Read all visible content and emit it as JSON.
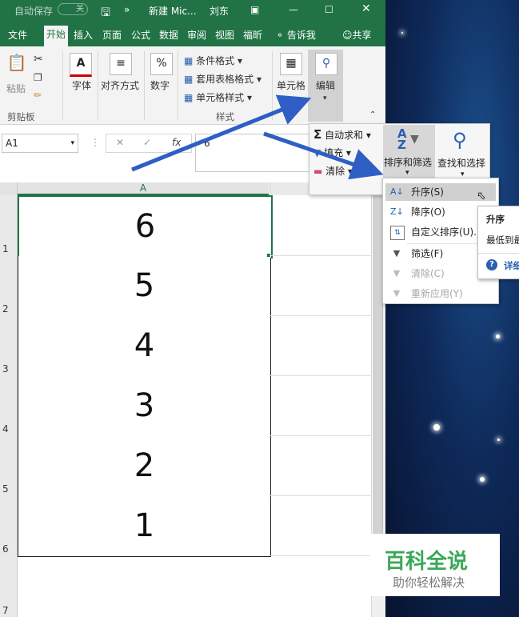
{
  "titlebar": {
    "autosave": "自动保存",
    "autosave_state": "关",
    "doc_title": "新建 Mic...",
    "user": "刘东"
  },
  "tabs": [
    "文件",
    "开始",
    "插入",
    "页面",
    "公式",
    "数据",
    "审阅",
    "视图",
    "福昕",
    "告诉我",
    "共享"
  ],
  "ribbon": {
    "paste": "粘贴",
    "clipboard_group": "剪贴板",
    "font": "字体",
    "align": "对齐方式",
    "number": "数字",
    "number_icon": "%",
    "cond_format": "条件格式",
    "table_format": "套用表格格式",
    "cell_style": "单元格样式",
    "styles_group": "样式",
    "cells": "单元格",
    "edit": "编辑"
  },
  "formula_bar": {
    "name_box": "A1",
    "value": "6"
  },
  "edit_dropdown": {
    "autosum": "自动求和",
    "fill": "填充",
    "clear": "清除",
    "sort_filter": "排序和筛选",
    "find_select": "查找和选择"
  },
  "sort_menu": [
    {
      "label": "升序(S)",
      "state": "hover",
      "icon": "sort-asc-icon"
    },
    {
      "label": "降序(O)",
      "state": "normal",
      "icon": "sort-desc-icon"
    },
    {
      "label": "自定义排序(U)...",
      "state": "normal",
      "icon": "custom-sort-icon"
    },
    {
      "label": "筛选(F)",
      "state": "normal",
      "icon": "filter-icon"
    },
    {
      "label": "清除(C)",
      "state": "disabled",
      "icon": "clear-filter-icon"
    },
    {
      "label": "重新应用(Y)",
      "state": "disabled",
      "icon": "reapply-icon"
    }
  ],
  "tooltip": {
    "title": "升序",
    "body": "最低到最",
    "more": "详细"
  },
  "sheet": {
    "column": "A",
    "rows": [
      "1",
      "2",
      "3",
      "4",
      "5",
      "6",
      "7"
    ],
    "values": [
      "6",
      "5",
      "4",
      "3",
      "2",
      "1"
    ]
  },
  "watermark": {
    "title": "百科全说",
    "subtitle": "助你轻松解决"
  },
  "colors": {
    "excel_green": "#217346",
    "arrow_blue": "#2f5fc4"
  }
}
